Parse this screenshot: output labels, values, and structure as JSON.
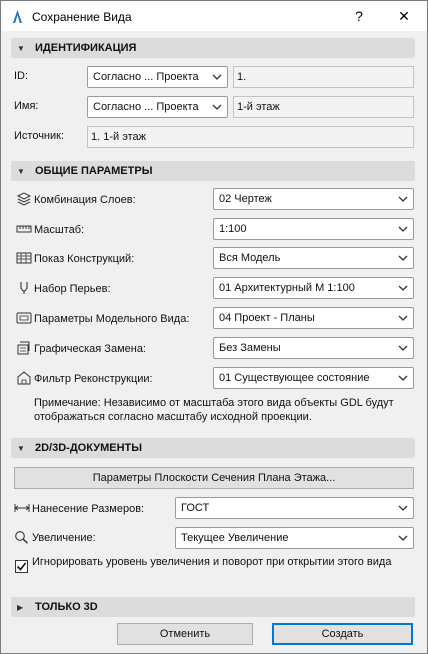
{
  "window": {
    "title": "Сохранение Вида",
    "help_label": "?",
    "close_label": "✕"
  },
  "identification": {
    "header": "ИДЕНТИФИКАЦИЯ",
    "id_label": "ID:",
    "id_select": "Согласно ... Проекта",
    "id_value": "1.",
    "name_label": "Имя:",
    "name_select": "Согласно ... Проекта",
    "name_value": "1-й этаж",
    "source_label": "Источник:",
    "source_value": "1. 1-й этаж"
  },
  "general": {
    "header": "ОБЩИЕ ПАРАМЕТРЫ",
    "rows": [
      {
        "label": "Комбинация Слоев:",
        "value": "02 Чертеж",
        "icon": "layers-icon"
      },
      {
        "label": "Масштаб:",
        "value": "1:100",
        "icon": "scale-ruler-icon"
      },
      {
        "label": "Показ Конструкций:",
        "value": "Вся Модель",
        "icon": "structure-display-icon"
      },
      {
        "label": "Набор Перьев:",
        "value": "01 Архитектурный М 1:100",
        "icon": "pen-icon"
      },
      {
        "label": "Параметры Модельного Вида:",
        "value": "04 Проект - Планы",
        "icon": "model-view-icon"
      },
      {
        "label": "Графическая Замена:",
        "value": "Без Замены",
        "icon": "graphic-override-icon"
      },
      {
        "label": "Фильтр Реконструкции:",
        "value": "01 Существующее состояние",
        "icon": "renovation-filter-icon"
      }
    ],
    "note": "Примечание: Независимо от масштаба этого вида объекты GDL будут отображаться согласно масштабу исходной проекции."
  },
  "docs2d3d": {
    "header": "2D/3D-ДОКУМЕНТЫ",
    "section_plane_button": "Параметры Плоскости Сечения Плана Этажа...",
    "dimension_label": "Нанесение Размеров:",
    "dimension_value": "ГОСТ",
    "zoom_label": "Увеличение:",
    "zoom_value": "Текущее Увеличение",
    "ignore_zoom_label": "Игнорировать уровень увеличения и поворот при открытии этого вида",
    "ignore_zoom_checked": true
  },
  "only3d": {
    "header": "ТОЛЬКО 3D"
  },
  "footer": {
    "cancel_label": "Отменить",
    "create_label": "Создать"
  },
  "colors": {
    "section_bg": "#dcdcdc",
    "primary_border": "#0078d7",
    "app_icon": "#1e73be"
  }
}
